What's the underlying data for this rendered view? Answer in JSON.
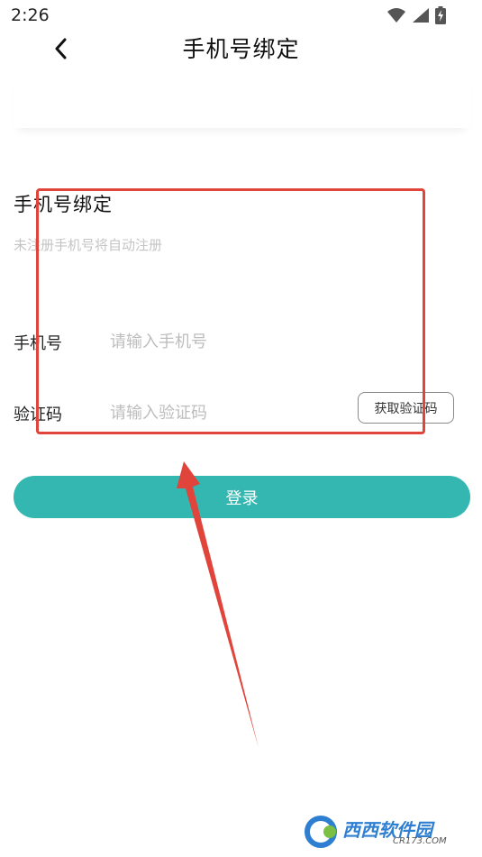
{
  "status_bar": {
    "time": "2:26"
  },
  "header": {
    "title": "手机号绑定"
  },
  "form": {
    "title": "手机号绑定",
    "subtitle": "未注册手机号将自动注册",
    "phone_label": "手机号",
    "phone_placeholder": "请输入手机号",
    "phone_value": "",
    "code_label": "验证码",
    "code_placeholder": "请输入验证码",
    "code_value": "",
    "get_code_label": "获取验证码"
  },
  "login_button": {
    "label": "登录"
  },
  "watermark": {
    "brand": "西西软件园",
    "site": "CR173.COM"
  },
  "colors": {
    "accent": "#33b7b0",
    "annotation": "#e0443a",
    "placeholder": "#bdbdbd"
  }
}
